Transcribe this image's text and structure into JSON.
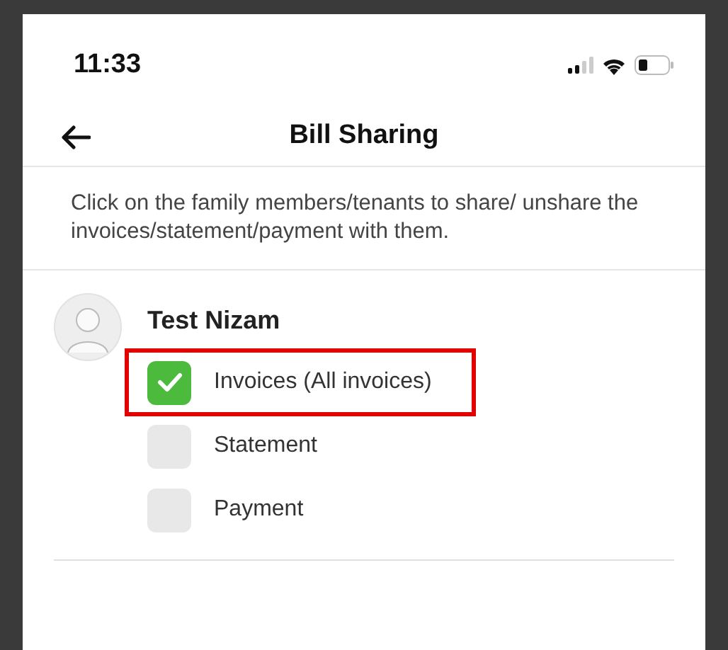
{
  "status_bar": {
    "time": "11:33"
  },
  "header": {
    "title": "Bill Sharing"
  },
  "description": "Click on the family members/tenants to share/ unshare the invoices/statement/payment with them.",
  "members": [
    {
      "name": "Test Nizam",
      "options": [
        {
          "label": "Invoices (All invoices)",
          "checked": true,
          "highlighted": true
        },
        {
          "label": "Statement",
          "checked": false,
          "highlighted": false
        },
        {
          "label": "Payment",
          "checked": false,
          "highlighted": false
        }
      ]
    }
  ]
}
